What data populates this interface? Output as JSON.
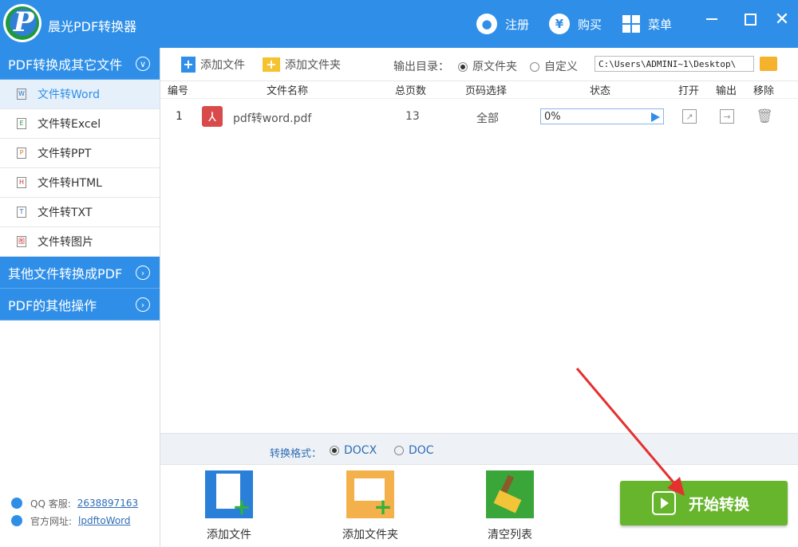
{
  "app": {
    "title": "晨光PDF转换器"
  },
  "header": {
    "register_label": "注册",
    "buy_label": "购买",
    "menu_label": "菜单"
  },
  "sidebar": {
    "sections": [
      {
        "label": "PDF转换成其它文件",
        "expanded": true
      },
      {
        "label": "其他文件转换成PDF",
        "expanded": false
      },
      {
        "label": "PDF的其他操作",
        "expanded": false
      }
    ],
    "items": [
      {
        "label": "文件转Word",
        "icon": "W",
        "active": true
      },
      {
        "label": "文件转Excel",
        "icon": "E"
      },
      {
        "label": "文件转PPT",
        "icon": "P"
      },
      {
        "label": "文件转HTML",
        "icon": "H"
      },
      {
        "label": "文件转TXT",
        "icon": "T"
      },
      {
        "label": "文件转图片",
        "icon": "图"
      }
    ],
    "footer": {
      "qq_label": "QQ 客服:",
      "qq_value": "2638897163",
      "site_label": "官方网址:",
      "site_value": "lpdftoWord"
    }
  },
  "toolbar": {
    "add_file_label": "添加文件",
    "add_folder_label": "添加文件夹",
    "output_dir_label": "输出目录：",
    "radio_source_label": "原文件夹",
    "radio_custom_label": "自定义",
    "output_path": "C:\\Users\\ADMINI~1\\Desktop\\"
  },
  "table": {
    "headers": [
      "编号",
      "文件名称",
      "总页数",
      "页码选择",
      "状态",
      "打开",
      "输出",
      "移除"
    ],
    "rows": [
      {
        "index": "1",
        "filename": "pdf转word.pdf",
        "pages": "13",
        "page_selection": "全部",
        "progress": "0%"
      }
    ]
  },
  "format": {
    "label": "转换格式：",
    "options": [
      "DOCX",
      "DOC"
    ],
    "selected": "DOCX"
  },
  "actions": {
    "add_file_label": "添加文件",
    "add_folder_label": "添加文件夹",
    "clear_list_label": "清空列表",
    "start_label": "开始转换"
  },
  "colors": {
    "accent": "#2f8fe8",
    "start_button": "#67b52d",
    "arrow": "#e53030"
  }
}
